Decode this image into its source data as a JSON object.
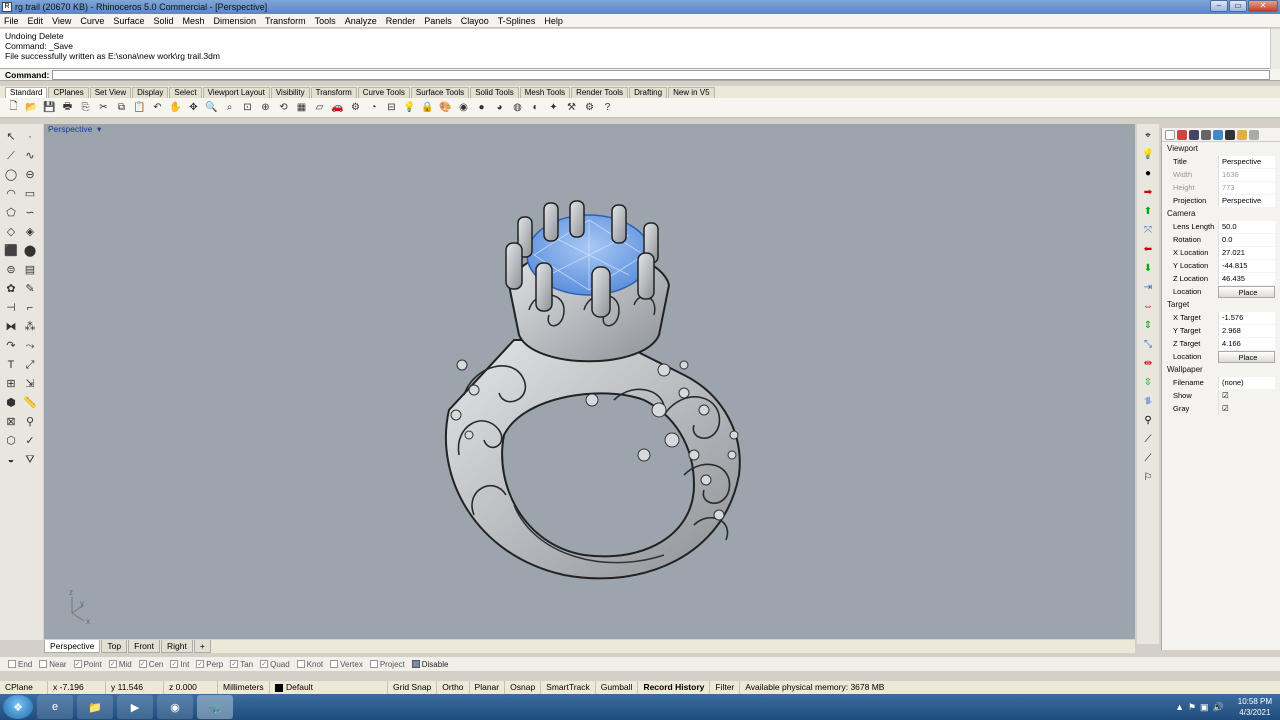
{
  "window": {
    "title": "rg trail (20670 KB) - Rhinoceros 5.0 Commercial - [Perspective]"
  },
  "menu": [
    "File",
    "Edit",
    "View",
    "Curve",
    "Surface",
    "Solid",
    "Mesh",
    "Dimension",
    "Transform",
    "Tools",
    "Analyze",
    "Render",
    "Panels",
    "Clayoo",
    "T-Splines",
    "Help"
  ],
  "command_history": [
    "Undoing Delete",
    "Command: _Save",
    "File successfully written as E:\\sona\\new work\\rg trail.3dm"
  ],
  "command_label": "Command:",
  "toolbar_tabs": [
    "Standard",
    "CPlanes",
    "Set View",
    "Display",
    "Select",
    "Viewport Layout",
    "Visibility",
    "Transform",
    "Curve Tools",
    "Surface Tools",
    "Solid Tools",
    "Mesh Tools",
    "Render Tools",
    "Drafting",
    "New in V5"
  ],
  "viewport": {
    "label": "Perspective",
    "axis_y": "y",
    "axis_x": "x",
    "axis_z": "z"
  },
  "view_tabs": [
    "Perspective",
    "Top",
    "Front",
    "Right",
    "+"
  ],
  "properties": {
    "viewport_section": "Viewport",
    "title_label": "Title",
    "title_value": "Perspective",
    "width_label": "Width",
    "width_value": "1636",
    "height_label": "Height",
    "height_value": "773",
    "projection_label": "Projection",
    "projection_value": "Perspective",
    "camera_section": "Camera",
    "lens_label": "Lens Length",
    "lens_value": "50.0",
    "rotation_label": "Rotation",
    "rotation_value": "0.0",
    "xloc_label": "X Location",
    "xloc_value": "27.021",
    "yloc_label": "Y Location",
    "yloc_value": "-44.815",
    "zloc_label": "Z Location",
    "zloc_value": "46.435",
    "location_label": "Location",
    "place_label": "Place",
    "target_section": "Target",
    "xt_label": "X Target",
    "xt_value": "-1.576",
    "yt_label": "Y Target",
    "yt_value": "2.968",
    "zt_label": "Z Target",
    "zt_value": "4.166",
    "tlocation_label": "Location",
    "tplace_label": "Place",
    "wallpaper_section": "Wallpaper",
    "filename_label": "Filename",
    "filename_value": "(none)",
    "show_label": "Show",
    "gray_label": "Gray"
  },
  "osnaps": [
    {
      "label": "End",
      "checked": false
    },
    {
      "label": "Near",
      "checked": false
    },
    {
      "label": "Point",
      "checked": true
    },
    {
      "label": "Mid",
      "checked": true
    },
    {
      "label": "Cen",
      "checked": true
    },
    {
      "label": "Int",
      "checked": true
    },
    {
      "label": "Perp",
      "checked": true
    },
    {
      "label": "Tan",
      "checked": true
    },
    {
      "label": "Quad",
      "checked": true
    },
    {
      "label": "Knot",
      "checked": false
    },
    {
      "label": "Vertex",
      "checked": false
    },
    {
      "label": "Project",
      "checked": false
    },
    {
      "label": "Disable",
      "checked": false
    }
  ],
  "status": {
    "cplane": "CPlane",
    "x": "x -7.196",
    "y": "y 11.546",
    "z": "z 0.000",
    "units": "Millimeters",
    "layer": "Default",
    "grid_snap": "Grid Snap",
    "ortho": "Ortho",
    "planar": "Planar",
    "osnap": "Osnap",
    "smarttrack": "SmartTrack",
    "gumball": "Gumball",
    "record_history": "Record History",
    "filter": "Filter",
    "memory": "Available physical memory: 3678 MB"
  },
  "taskbar": {
    "time": "10:58 PM",
    "date": "4/3/2021"
  },
  "colors": {
    "viewport_bg": "#9ca4ad",
    "gem": "#7aa8ec",
    "metal": "#c9ccd0",
    "titlebar": "#6b92cc"
  }
}
